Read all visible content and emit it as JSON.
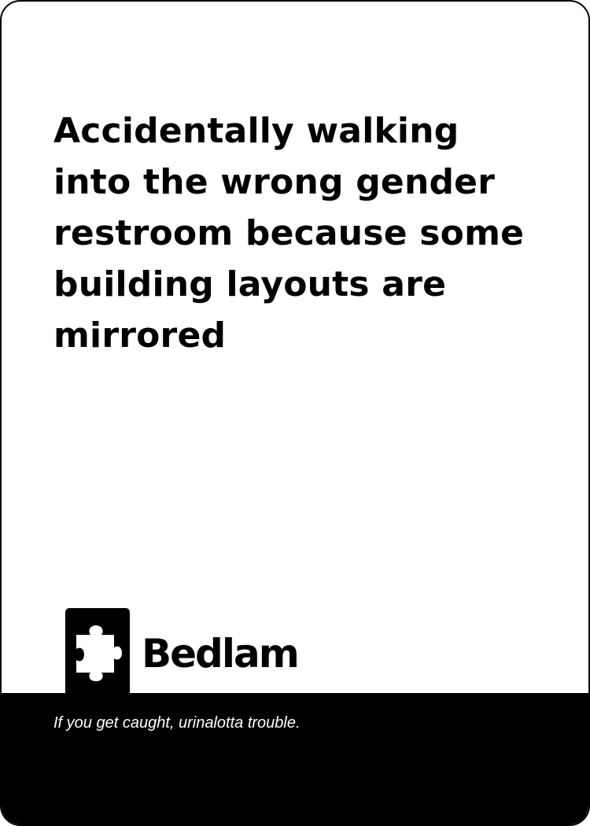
{
  "card": {
    "prompt": "Accidentally walking into the wrong gender restroom because some building layouts are mirrored",
    "brand": "Bedlam",
    "tagline": "If you get caught, urinalotta trouble.",
    "logo_icon": "puzzle-piece-icon"
  }
}
